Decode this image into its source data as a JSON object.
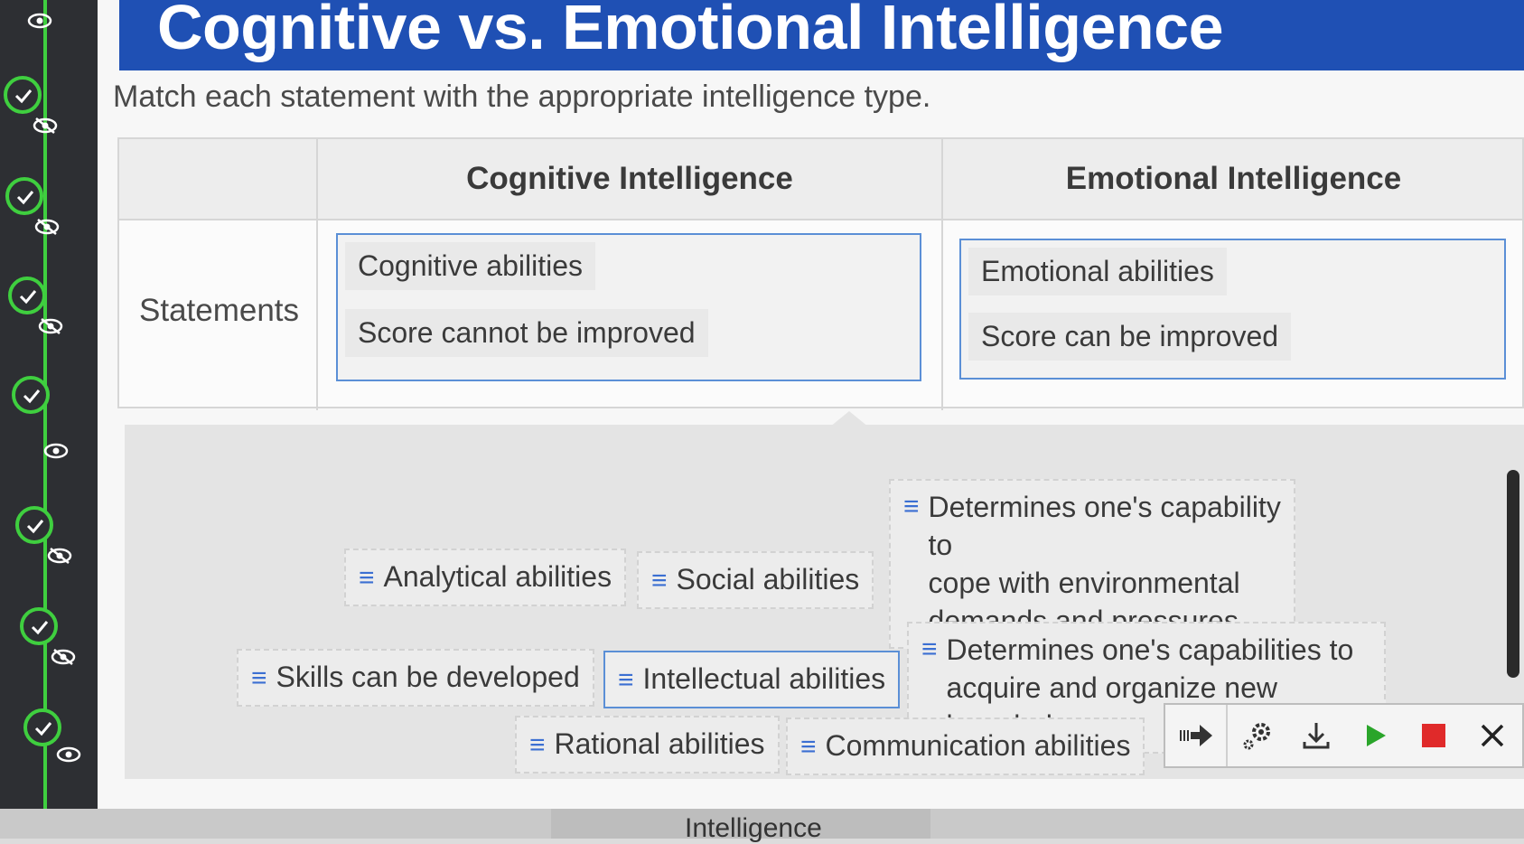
{
  "header": {
    "title": "Cognitive vs. Emotional Intelligence",
    "instructions": "Match each statement with the appropriate intelligence type."
  },
  "table": {
    "columns": [
      "Cognitive Intelligence",
      "Emotional Intelligence"
    ],
    "row_label": "Statements",
    "cognitive_items": [
      "Cognitive abilities",
      "Score cannot be improved"
    ],
    "emotional_items": [
      "Emotional abilities",
      "Score can be improved"
    ]
  },
  "bank": {
    "chips": [
      {
        "label": "Analytical abilities"
      },
      {
        "label": "Social abilities"
      },
      {
        "label": "Determines one's capability to",
        "line2": "cope with environmental",
        "line3": "demands and pressures"
      },
      {
        "label": "Skills can be developed"
      },
      {
        "label": "Intellectual abilities"
      },
      {
        "label": "Determines one's capabilities to",
        "line2": "acquire and organize new knowledge"
      },
      {
        "label": "Rational abilities"
      },
      {
        "label": "Communication abilities"
      }
    ],
    "handle_glyph": "≡"
  },
  "footer": {
    "partial_text": "Intelligence"
  },
  "toolbar": {
    "icons": [
      "step-forward-icon",
      "settings-icon",
      "download-icon",
      "play-icon",
      "stop-icon",
      "close-icon"
    ],
    "colors": {
      "play": "#2aa52a",
      "stop": "#e02a2a"
    }
  },
  "progress": {
    "completed_steps": 7,
    "accent": "#3fcf3f"
  }
}
